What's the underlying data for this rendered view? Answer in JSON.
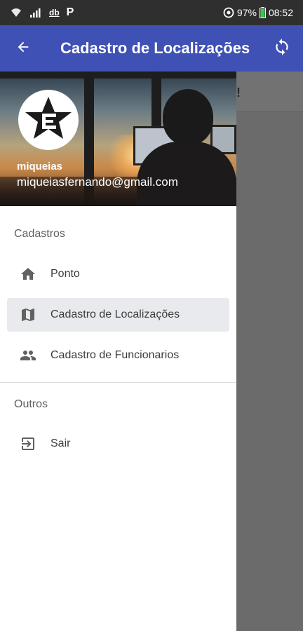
{
  "status_bar": {
    "battery": "97%",
    "time": "08:52",
    "icons": [
      "wifi-calling-icon",
      "signal-icon",
      "db-icon",
      "parking-app-icon",
      "sync-status-icon",
      "battery-icon"
    ],
    "db_text": "db",
    "p_text": "P"
  },
  "app_bar": {
    "title": "Cadastro de Localizações",
    "back_icon": "arrow-back-icon",
    "refresh_icon": "sync-icon",
    "bg_color": "#3f51b5"
  },
  "behind_content": {
    "visible_text": "!"
  },
  "drawer": {
    "user": {
      "name": "miqueias",
      "email": "miqueiasfernando@gmail.com"
    },
    "sections": [
      {
        "label": "Cadastros",
        "items": [
          {
            "label": "Ponto",
            "icon": "home-icon",
            "active": false
          },
          {
            "label": "Cadastro de Localizações",
            "icon": "map-icon",
            "active": true
          },
          {
            "label": "Cadastro de Funcionarios",
            "icon": "people-icon",
            "active": false
          }
        ]
      },
      {
        "label": "Outros",
        "items": [
          {
            "label": "Sair",
            "icon": "exit-icon",
            "active": false
          }
        ]
      }
    ]
  }
}
